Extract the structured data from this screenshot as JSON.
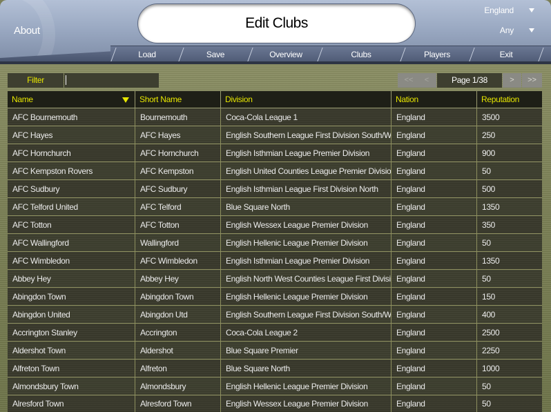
{
  "header": {
    "about_label": "About",
    "title": "Edit Clubs",
    "nation_select": {
      "value": "England"
    },
    "type_select": {
      "value": "Any"
    }
  },
  "nav": {
    "items": [
      {
        "label": "Load"
      },
      {
        "label": "Save"
      },
      {
        "label": "Overview"
      },
      {
        "label": "Clubs"
      },
      {
        "label": "Players"
      },
      {
        "label": "Exit"
      }
    ]
  },
  "filter": {
    "label": "Filter",
    "value": ""
  },
  "pagination": {
    "first_label": "<<",
    "prev_label": "<",
    "page_label": "Page 1/38",
    "current_page": 1,
    "total_pages": 38,
    "next_label": ">",
    "last_label": ">>"
  },
  "table": {
    "columns": [
      {
        "label": "Name",
        "sorted": "desc"
      },
      {
        "label": "Short Name"
      },
      {
        "label": "Division"
      },
      {
        "label": "Nation"
      },
      {
        "label": "Reputation"
      }
    ],
    "rows": [
      {
        "name": "AFC Bournemouth",
        "short": "Bournemouth",
        "division": "Coca-Cola League 1",
        "nation": "England",
        "reputation": "3500"
      },
      {
        "name": "AFC Hayes",
        "short": "AFC Hayes",
        "division": "English Southern League First Division South/West",
        "nation": "England",
        "reputation": "250"
      },
      {
        "name": "AFC Hornchurch",
        "short": "AFC Hornchurch",
        "division": "English Isthmian League Premier Division",
        "nation": "England",
        "reputation": "900"
      },
      {
        "name": "AFC Kempston Rovers",
        "short": "AFC Kempston",
        "division": "English United Counties League Premier Division",
        "nation": "England",
        "reputation": "50"
      },
      {
        "name": "AFC Sudbury",
        "short": "AFC Sudbury",
        "division": "English Isthmian League First Division North",
        "nation": "England",
        "reputation": "500"
      },
      {
        "name": "AFC Telford United",
        "short": "AFC Telford",
        "division": "Blue Square North",
        "nation": "England",
        "reputation": "1350"
      },
      {
        "name": "AFC Totton",
        "short": "AFC Totton",
        "division": "English Wessex League Premier Division",
        "nation": "England",
        "reputation": "350"
      },
      {
        "name": "AFC Wallingford",
        "short": "Wallingford",
        "division": "English Hellenic League Premier Division",
        "nation": "England",
        "reputation": "50"
      },
      {
        "name": "AFC Wimbledon",
        "short": "AFC Wimbledon",
        "division": "English Isthmian League Premier Division",
        "nation": "England",
        "reputation": "1350"
      },
      {
        "name": "Abbey Hey",
        "short": "Abbey Hey",
        "division": "English North West Counties League First Division",
        "nation": "England",
        "reputation": "50"
      },
      {
        "name": "Abingdon Town",
        "short": "Abingdon Town",
        "division": "English Hellenic League Premier Division",
        "nation": "England",
        "reputation": "150"
      },
      {
        "name": "Abingdon United",
        "short": "Abingdon Utd",
        "division": "English Southern League First Division South/West",
        "nation": "England",
        "reputation": "400"
      },
      {
        "name": "Accrington Stanley",
        "short": "Accrington",
        "division": "Coca-Cola League 2",
        "nation": "England",
        "reputation": "2500"
      },
      {
        "name": "Aldershot Town",
        "short": "Aldershot",
        "division": "Blue Square Premier",
        "nation": "England",
        "reputation": "2250"
      },
      {
        "name": "Alfreton Town",
        "short": "Alfreton",
        "division": "Blue Square North",
        "nation": "England",
        "reputation": "1000"
      },
      {
        "name": "Almondsbury Town",
        "short": "Almondsbury",
        "division": "English Hellenic League Premier Division",
        "nation": "England",
        "reputation": "50"
      },
      {
        "name": "Alresford Town",
        "short": "Alresford Town",
        "division": "English Wessex League Premier Division",
        "nation": "England",
        "reputation": "50"
      }
    ]
  },
  "colors": {
    "accent_yellow": "#e6e600",
    "header_blue": "#9aa9c2",
    "row_dark": "#39392b"
  }
}
